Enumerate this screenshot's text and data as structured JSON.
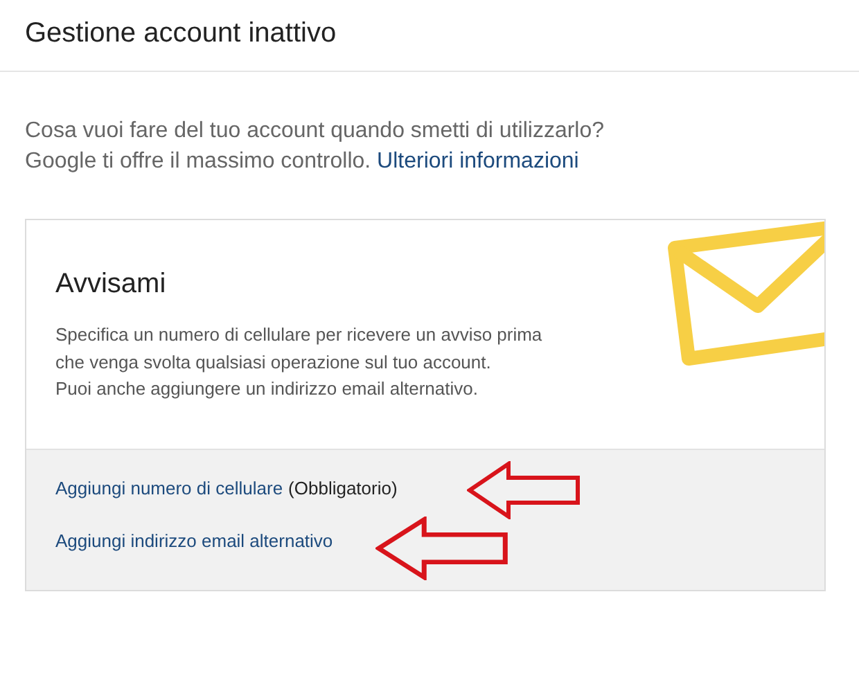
{
  "page": {
    "title": "Gestione account inattivo"
  },
  "intro": {
    "text": "Cosa vuoi fare del tuo account quando smetti di utilizzarlo? Google ti offre il massimo controllo.",
    "link": "Ulteriori informazioni"
  },
  "card": {
    "title": "Avvisami",
    "description": [
      "Specifica un numero di cellulare per ricevere un avviso prima",
      "che venga svolta qualsiasi operazione sul tuo account.",
      "Puoi anche aggiungere un indirizzo email alternativo."
    ],
    "actions": [
      {
        "label": "Aggiungi numero di cellulare",
        "note": "(Obbligatorio)"
      },
      {
        "label": "Aggiungi indirizzo email alternativo"
      }
    ]
  }
}
